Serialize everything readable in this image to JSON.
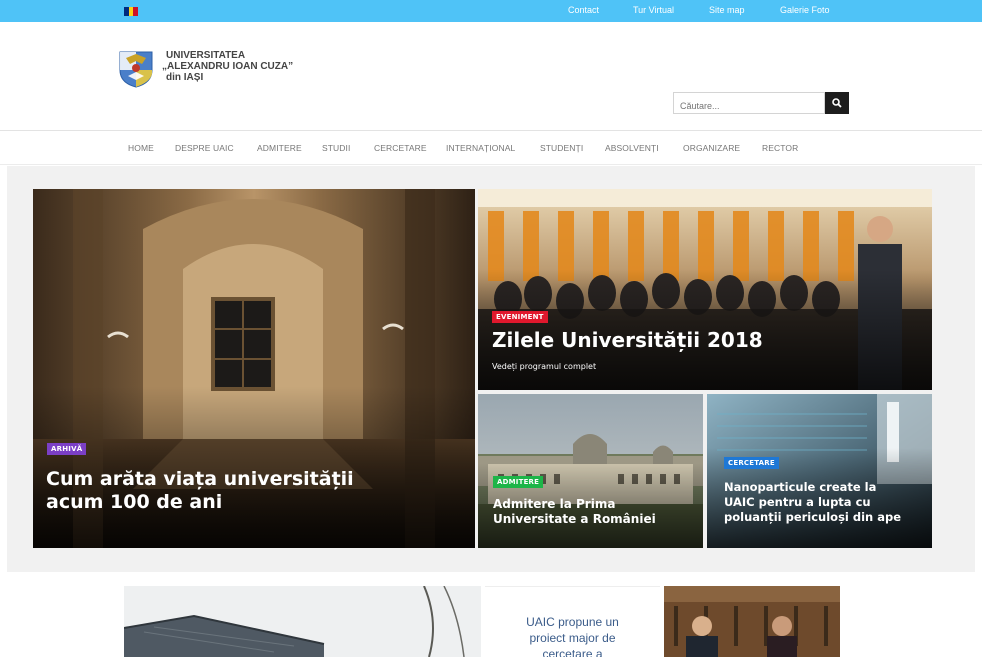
{
  "topbar": {
    "flag_colors": [
      "#002B7F",
      "#FCD116",
      "#CE1126"
    ],
    "links": [
      "Contact",
      "Tur Virtual",
      "Site map",
      "Galerie Foto"
    ]
  },
  "header": {
    "crest": "university-crest-logo",
    "name_line1": "UNIVERSITATEA",
    "name_line2": "„ALEXANDRU IOAN CUZA”",
    "name_line3": "din IAȘI",
    "search_placeholder": "Căutare...",
    "search_icon": "search-icon"
  },
  "nav": {
    "items": [
      "HOME",
      "DESPRE UAIC",
      "ADMITERE",
      "STUDII",
      "CERCETARE",
      "INTERNAȚIONAL",
      "STUDENȚI",
      "ABSOLVENȚI",
      "ORGANIZARE",
      "RECTOR"
    ]
  },
  "hero": {
    "main": {
      "badge": "ARHIVĂ",
      "badge_color": "#7b3fc6",
      "title_line1": "Cum arăta viața universității",
      "title_line2": "acum 100 de ani"
    },
    "event": {
      "badge": "EVENIMENT",
      "badge_color": "#e0182d",
      "title": "Zilele Universității 2018",
      "subtitle": "Vedeți programul complet"
    },
    "admission": {
      "badge": "ADMITERE",
      "badge_color": "#1db548",
      "title_line1": "Admitere la Prima",
      "title_line2": "Universitate a României"
    },
    "research": {
      "badge": "CERCETARE",
      "badge_color": "#1e78d6",
      "title_line1": "Nanoparticule create la",
      "title_line2": "UAIC pentru a lupta cu",
      "title_line3": "poluanții periculoși din ape"
    }
  },
  "news": {
    "card_line1": "UAIC propune un",
    "card_line2": "proiect major de",
    "card_line3": "cercetare a"
  }
}
